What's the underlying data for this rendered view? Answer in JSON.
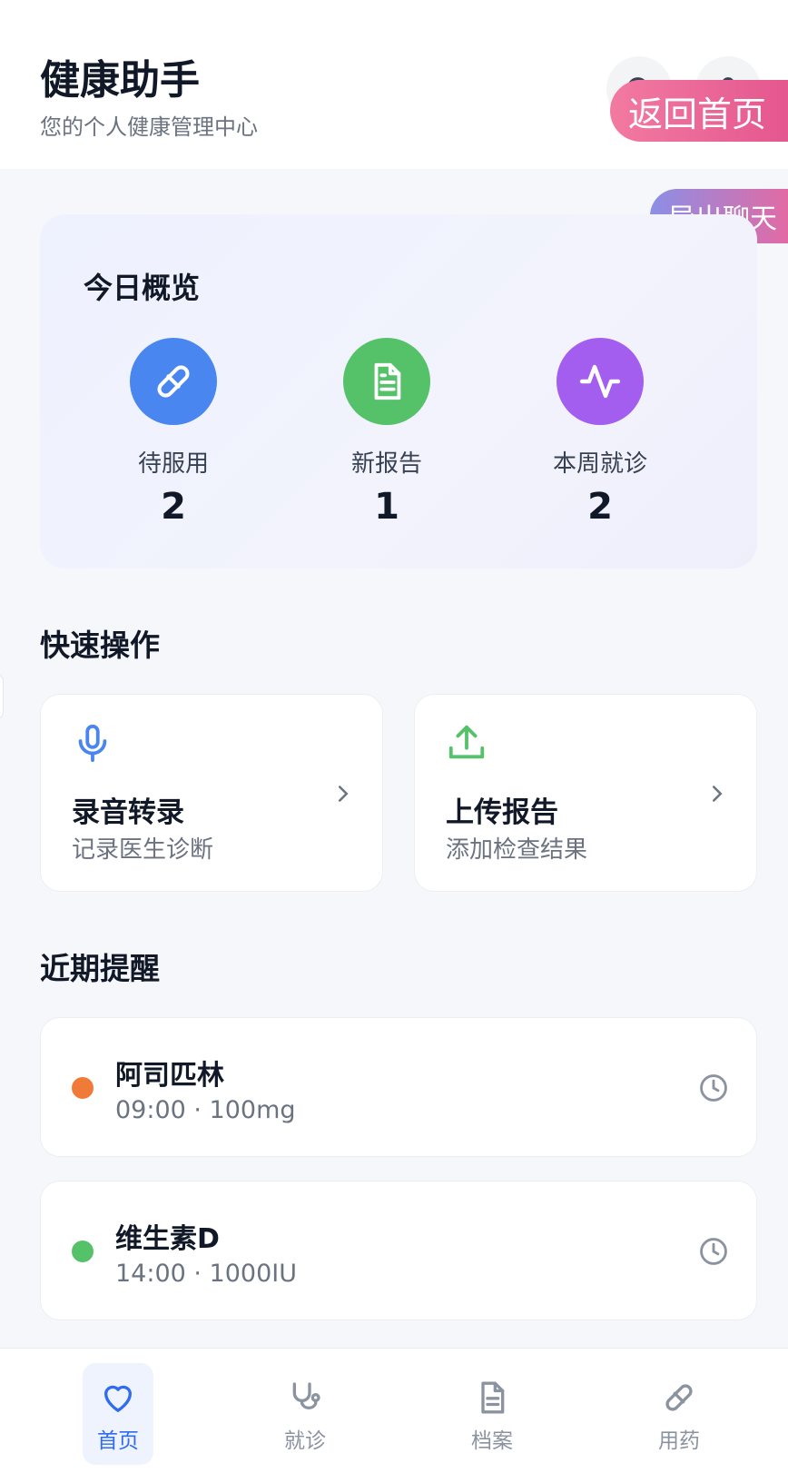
{
  "header": {
    "title": "健康助手",
    "subtitle": "您的个人健康管理中心",
    "search_icon": "search-icon",
    "user_icon": "user-icon"
  },
  "overlays": {
    "home_button": "返回首页",
    "export_button": "导出聊天"
  },
  "overview": {
    "title": "今日概览",
    "stats": [
      {
        "icon": "pill-icon",
        "label": "待服用",
        "value": "2",
        "color": "#4a86f0"
      },
      {
        "icon": "document-icon",
        "label": "新报告",
        "value": "1",
        "color": "#55c26a"
      },
      {
        "icon": "activity-icon",
        "label": "本周就诊",
        "value": "2",
        "color": "#a35ef0"
      }
    ]
  },
  "quick_actions": {
    "title": "快速操作",
    "items": [
      {
        "icon": "microphone-icon",
        "title": "录音转录",
        "subtitle": "记录医生诊断",
        "color": "#4a86f0"
      },
      {
        "icon": "upload-icon",
        "title": "上传报告",
        "subtitle": "添加检查结果",
        "color": "#55c26a"
      }
    ]
  },
  "reminders": {
    "title": "近期提醒",
    "items": [
      {
        "name": "阿司匹林",
        "detail": "09:00 · 100mg",
        "dot_color": "#f07b38"
      },
      {
        "name": "维生素D",
        "detail": "14:00 · 1000IU",
        "dot_color": "#55c26a"
      }
    ]
  },
  "bottom_nav": {
    "items": [
      {
        "icon": "heart-icon",
        "label": "首页",
        "active": true
      },
      {
        "icon": "stethoscope-icon",
        "label": "就诊",
        "active": false
      },
      {
        "icon": "document-icon",
        "label": "档案",
        "active": false
      },
      {
        "icon": "pill-icon",
        "label": "用药",
        "active": false
      }
    ]
  },
  "colors": {
    "accent": "#2f6cf0",
    "home_pill": "#e4578f",
    "export_pill": "#8b8fe6"
  }
}
